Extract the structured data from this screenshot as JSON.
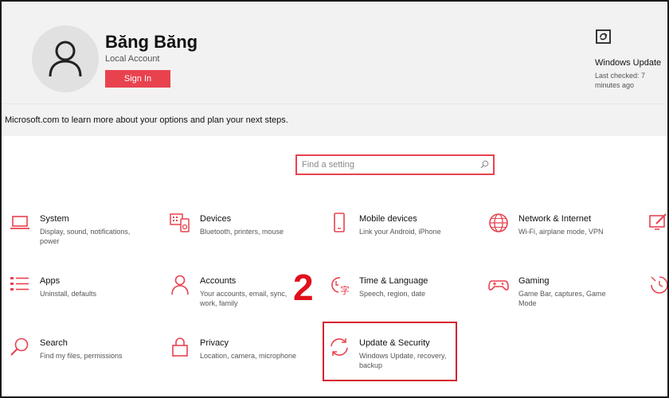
{
  "account": {
    "name": "Băng Băng",
    "type": "Local Account",
    "signin_label": "Sign In"
  },
  "windows_update": {
    "title": "Windows Update",
    "status": "Last checked: 7 minutes ago"
  },
  "banner": {
    "text": "Microsoft.com to learn more about your options and plan your next steps."
  },
  "search": {
    "placeholder": "Find a setting"
  },
  "categories": [
    {
      "title": "System",
      "desc": "Display, sound, notifications, power",
      "icon": "laptop-icon"
    },
    {
      "title": "Devices",
      "desc": "Bluetooth, printers, mouse",
      "icon": "devices-icon"
    },
    {
      "title": "Mobile devices",
      "desc": "Link your Android, iPhone",
      "icon": "phone-icon"
    },
    {
      "title": "Network & Internet",
      "desc": "Wi-Fi, airplane mode, VPN",
      "icon": "globe-icon"
    },
    {
      "title": "Apps",
      "desc": "Uninstall, defaults",
      "icon": "apps-list-icon"
    },
    {
      "title": "Accounts",
      "desc": "Your accounts, email, sync, work, family",
      "icon": "person-icon"
    },
    {
      "title": "Time & Language",
      "desc": "Speech, region, date",
      "icon": "time-language-icon"
    },
    {
      "title": "Gaming",
      "desc": "Game Bar, captures, Game Mode",
      "icon": "gamepad-icon"
    },
    {
      "title": "Search",
      "desc": "Find my files, permissions",
      "icon": "search-icon"
    },
    {
      "title": "Privacy",
      "desc": "Location, camera, microphone",
      "icon": "lock-icon"
    },
    {
      "title": "Update & Security",
      "desc": "Windows Update, recovery, backup",
      "icon": "sync-icon"
    }
  ],
  "annotation": {
    "step_number": "2"
  },
  "colors": {
    "accent": "#e8424f",
    "header_bg": "#f2f2f2",
    "highlight": "#d3232f"
  }
}
